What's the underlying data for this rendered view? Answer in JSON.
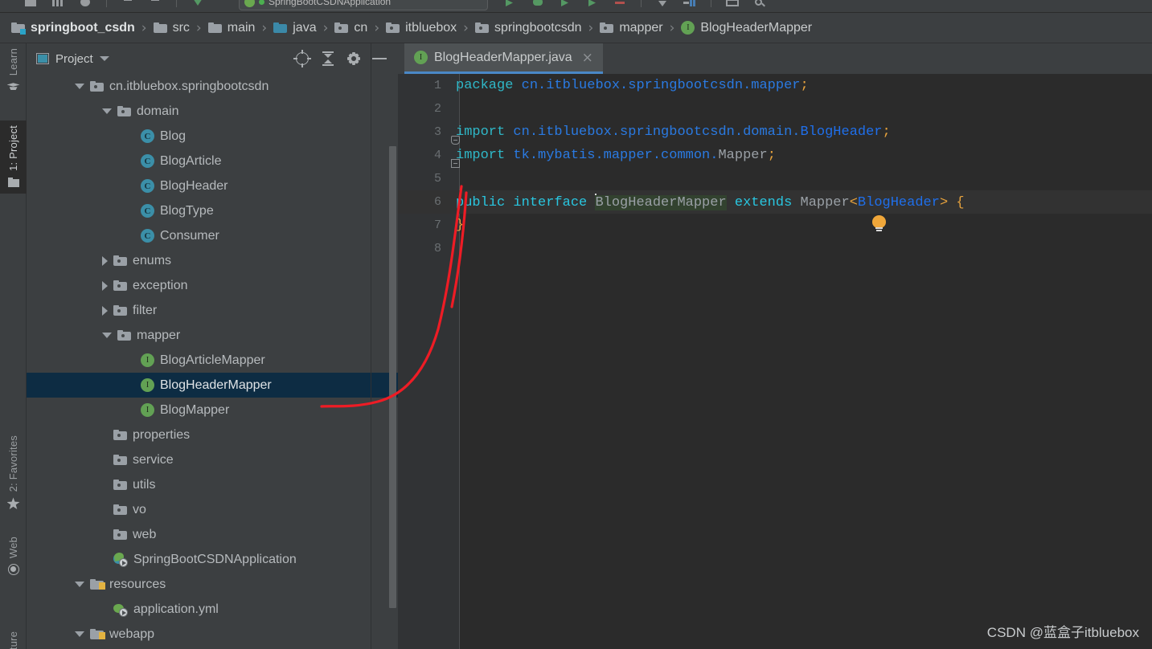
{
  "window": {
    "title": "BlogHeaderMapper.java"
  },
  "toolbar": {
    "run_config_label": "SpringBootCSDNApplication",
    "icons": [
      "open-icon",
      "sync-icon",
      "undo-icon",
      "redo-icon",
      "cut-icon",
      "copy-icon",
      "paste-icon",
      "build-icon",
      "run-icon",
      "debug-icon",
      "run-coverage-icon",
      "stop-icon",
      "dropdown-icon",
      "pause-icon",
      "layout-icon",
      "search-icon"
    ]
  },
  "breadcrumb": {
    "items": [
      {
        "label": "springboot_csdn",
        "icon": "module-folder-icon"
      },
      {
        "label": "src",
        "icon": "folder-icon"
      },
      {
        "label": "main",
        "icon": "folder-icon"
      },
      {
        "label": "java",
        "icon": "source-folder-icon"
      },
      {
        "label": "cn",
        "icon": "package-icon"
      },
      {
        "label": "itbluebox",
        "icon": "package-icon"
      },
      {
        "label": "springbootcsdn",
        "icon": "package-icon"
      },
      {
        "label": "mapper",
        "icon": "package-icon"
      },
      {
        "label": "BlogHeaderMapper",
        "icon": "interface-icon"
      }
    ],
    "separator": "›"
  },
  "rails": {
    "left_top": [
      {
        "label": "Learn",
        "icon": "graduation-cap-icon",
        "active": false
      },
      {
        "label": "1: Project",
        "icon": "folder-icon",
        "active": true
      }
    ],
    "left_bottom": [
      {
        "label": "2: Favorites",
        "icon": "star-icon",
        "active": false
      },
      {
        "label": "Web",
        "icon": "globe-icon",
        "active": false
      },
      {
        "label": "ture",
        "icon": "",
        "active": false
      }
    ]
  },
  "project_panel": {
    "title": "Project",
    "title_caret": "▼",
    "actions": [
      {
        "name": "select-opened-file-icon"
      },
      {
        "name": "collapse-all-icon"
      },
      {
        "name": "settings-gear-icon"
      },
      {
        "name": "hide-panel-icon"
      }
    ],
    "tree": [
      {
        "label": "cn.itbluebox.springbootcsdn",
        "icon": "package-icon",
        "arrow": "down",
        "indent": 1,
        "selected": false
      },
      {
        "label": "domain",
        "icon": "package-icon",
        "arrow": "down",
        "indent": 2,
        "selected": false
      },
      {
        "label": "Blog",
        "icon": "class-icon",
        "arrow": "none",
        "indent": 3,
        "selected": false
      },
      {
        "label": "BlogArticle",
        "icon": "class-icon",
        "arrow": "none",
        "indent": 3,
        "selected": false
      },
      {
        "label": "BlogHeader",
        "icon": "class-icon",
        "arrow": "none",
        "indent": 3,
        "selected": false
      },
      {
        "label": "BlogType",
        "icon": "class-icon",
        "arrow": "none",
        "indent": 3,
        "selected": false
      },
      {
        "label": "Consumer",
        "icon": "class-icon",
        "arrow": "none",
        "indent": 3,
        "selected": false
      },
      {
        "label": "enums",
        "icon": "package-icon",
        "arrow": "right",
        "indent": 2,
        "selected": false
      },
      {
        "label": "exception",
        "icon": "package-icon",
        "arrow": "right",
        "indent": 2,
        "selected": false
      },
      {
        "label": "filter",
        "icon": "package-icon",
        "arrow": "right",
        "indent": 2,
        "selected": false
      },
      {
        "label": "mapper",
        "icon": "package-icon",
        "arrow": "down",
        "indent": 2,
        "selected": false
      },
      {
        "label": "BlogArticleMapper",
        "icon": "interface-icon",
        "arrow": "none",
        "indent": 3,
        "selected": false
      },
      {
        "label": "BlogHeaderMapper",
        "icon": "interface-icon",
        "arrow": "none",
        "indent": 3,
        "selected": true
      },
      {
        "label": "BlogMapper",
        "icon": "interface-icon",
        "arrow": "none",
        "indent": 3,
        "selected": false
      },
      {
        "label": "properties",
        "icon": "package-icon",
        "arrow": "none",
        "indent": 2,
        "selected": false
      },
      {
        "label": "service",
        "icon": "package-icon",
        "arrow": "none",
        "indent": 2,
        "selected": false
      },
      {
        "label": "utils",
        "icon": "package-icon",
        "arrow": "none",
        "indent": 2,
        "selected": false
      },
      {
        "label": "vo",
        "icon": "package-icon",
        "arrow": "none",
        "indent": 2,
        "selected": false
      },
      {
        "label": "web",
        "icon": "package-icon",
        "arrow": "none",
        "indent": 2,
        "selected": false
      },
      {
        "label": "SpringBootCSDNApplication",
        "icon": "spring-boot-class-icon",
        "arrow": "none",
        "indent": 2,
        "selected": false
      },
      {
        "label": "resources",
        "icon": "resource-folder-icon",
        "arrow": "down",
        "indent": 1,
        "selected": false
      },
      {
        "label": "application.yml",
        "icon": "spring-yaml-icon",
        "arrow": "none",
        "indent": 2,
        "selected": false
      },
      {
        "label": "webapp",
        "icon": "resource-folder-icon",
        "arrow": "down",
        "indent": 1,
        "selected": false
      }
    ]
  },
  "editor": {
    "tab": {
      "label": "BlogHeaderMapper.java",
      "icon": "interface-icon",
      "close": "×"
    },
    "lines": [
      {
        "num": "1",
        "current": false,
        "fold": "none",
        "tokens": [
          {
            "t": "package ",
            "c": "kw"
          },
          {
            "t": "cn.itbluebox.springbootcsdn.mapper",
            "c": "pkg"
          },
          {
            "t": ";",
            "c": "punct"
          }
        ]
      },
      {
        "num": "2",
        "current": false,
        "fold": "none",
        "tokens": []
      },
      {
        "num": "3",
        "current": false,
        "fold": "start",
        "tokens": [
          {
            "t": "import ",
            "c": "kw"
          },
          {
            "t": "cn.itbluebox.springbootcsdn.domain.",
            "c": "pkg"
          },
          {
            "t": "BlogHeader",
            "c": "pkg-b"
          },
          {
            "t": ";",
            "c": "punct"
          }
        ]
      },
      {
        "num": "4",
        "current": false,
        "fold": "end",
        "tokens": [
          {
            "t": "import ",
            "c": "kw"
          },
          {
            "t": "tk.mybatis.mapper.common.",
            "c": "pkg"
          },
          {
            "t": "Mapper",
            "c": "gray"
          },
          {
            "t": ";",
            "c": "punct"
          }
        ]
      },
      {
        "num": "5",
        "current": false,
        "fold": "none",
        "tokens": []
      },
      {
        "num": "6",
        "current": true,
        "fold": "none",
        "tokens": [
          {
            "t": "public interface ",
            "c": "kw2"
          },
          {
            "t": "BlogHeaderMapper",
            "c": "ident-hl"
          },
          {
            "t": " ",
            "c": "plain"
          },
          {
            "t": "extends ",
            "c": "kw2"
          },
          {
            "t": "Mapper",
            "c": "gray"
          },
          {
            "t": "<",
            "c": "punct"
          },
          {
            "t": "BlogHeader",
            "c": "pkg-b"
          },
          {
            "t": ">",
            "c": "punct"
          },
          {
            "t": " {",
            "c": "punct"
          }
        ]
      },
      {
        "num": "7",
        "current": false,
        "fold": "none",
        "tokens": [
          {
            "t": "}",
            "c": "punct"
          }
        ]
      },
      {
        "num": "8",
        "current": false,
        "fold": "none",
        "tokens": []
      }
    ],
    "hint": {
      "icon": "lightbulb-icon"
    }
  },
  "annotation": {
    "type": "red-arrow",
    "color": "#ee1c25",
    "description": "arrow from BlogHeaderMapper tree node to interface declaration line"
  },
  "watermark": {
    "text": "CSDN @蓝盒子itbluebox"
  },
  "colors": {
    "panel_bg": "#3c3f41",
    "editor_bg": "#2b2b2b",
    "selection_bg": "#0d2c43",
    "tab_underline": "#4a88c7",
    "interface_icon": "#62a154",
    "class_icon": "#3b8fa8",
    "annotation": "#ee1c25"
  }
}
